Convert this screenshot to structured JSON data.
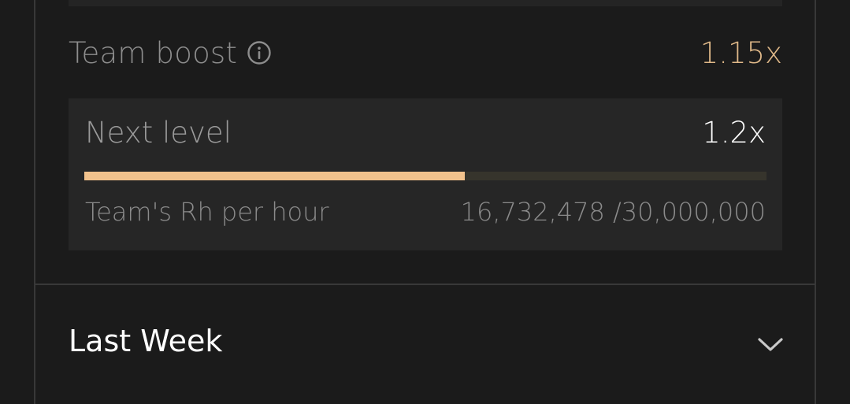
{
  "team_boost": {
    "label": "Team boost",
    "value": "1.15x"
  },
  "next_level": {
    "label": "Next level",
    "value": "1.2x",
    "progress_fraction": 0.5577
  },
  "team_rh": {
    "label": "Team's Rh per hour",
    "value": "16,732,478 /30,000,000"
  },
  "last_week": {
    "label": "Last Week"
  },
  "colors": {
    "background": "#1b1b1b",
    "card": "#262626",
    "accent": "#e0b989",
    "progress_fill": "#f2c28c",
    "progress_track": "#36342c"
  },
  "icons": {
    "info": "info-circle-icon",
    "chevron": "chevron-down-icon"
  }
}
